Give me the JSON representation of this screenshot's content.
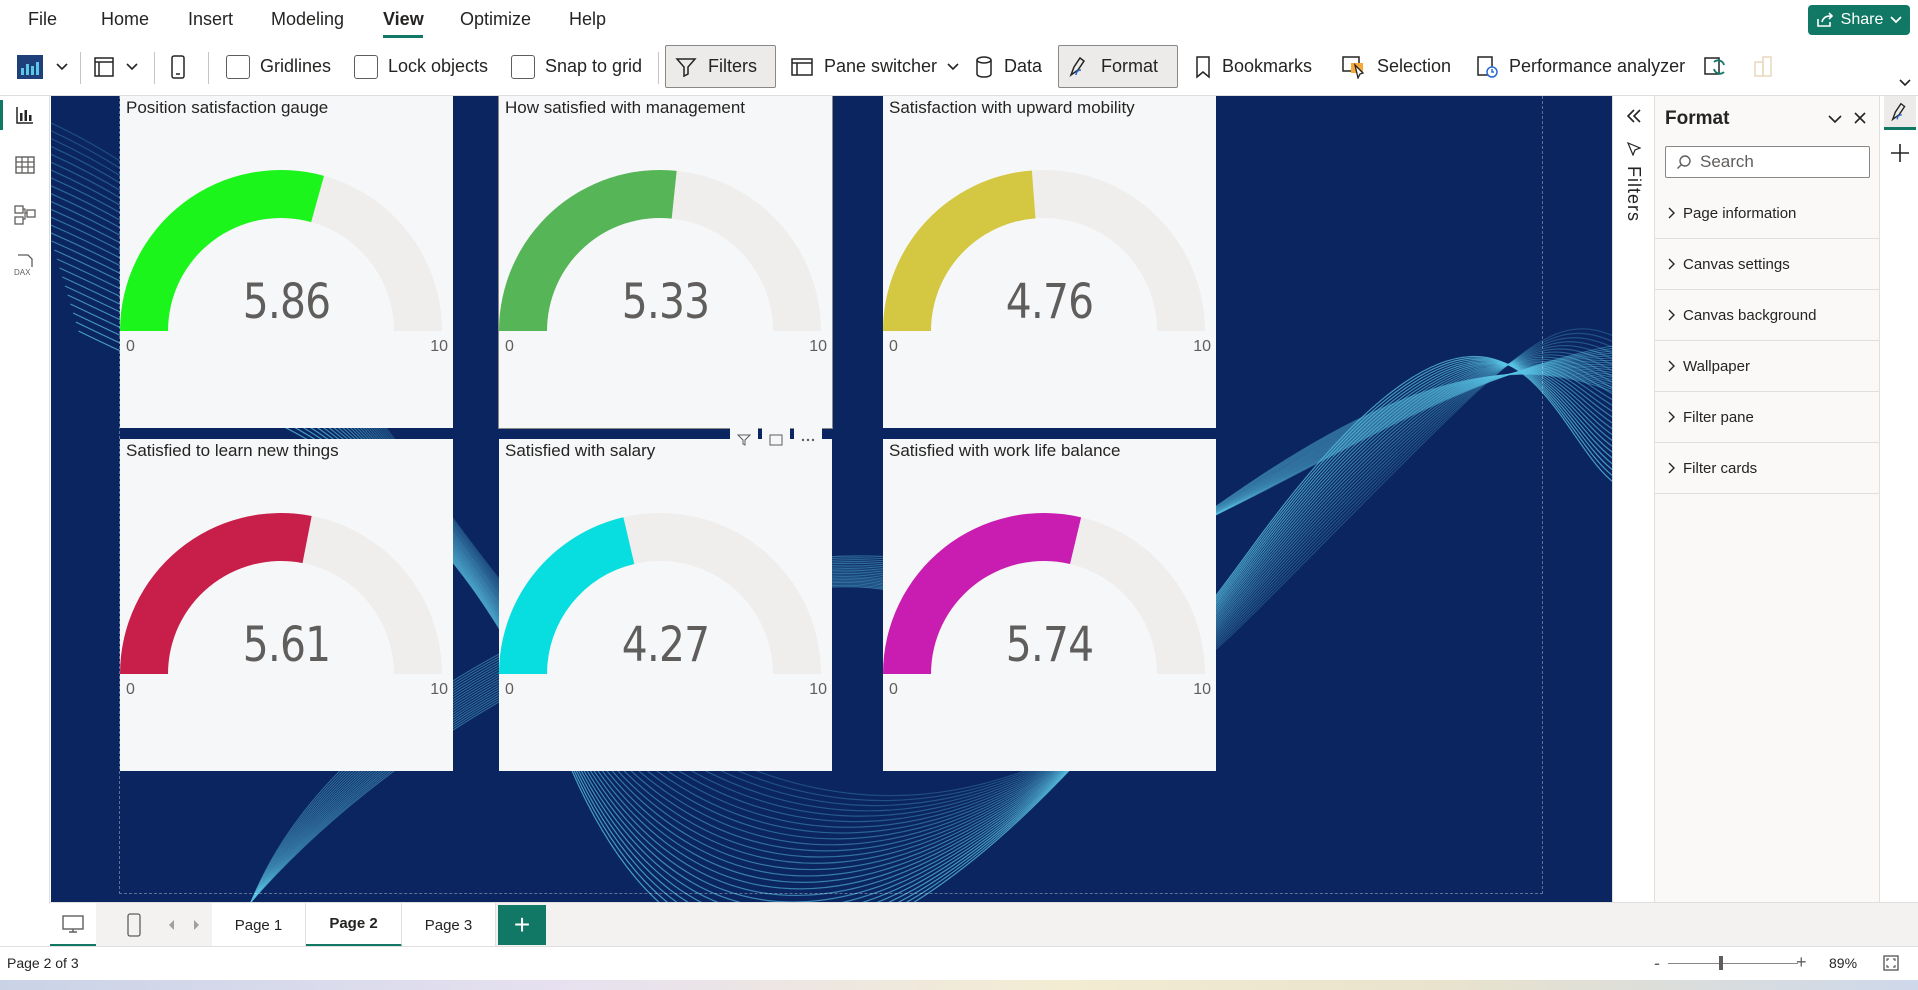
{
  "menu": {
    "items": [
      "File",
      "Home",
      "Insert",
      "Modeling",
      "View",
      "Optimize",
      "Help"
    ],
    "active": "View",
    "share_label": "Share"
  },
  "ribbon": {
    "gridlines": "Gridlines",
    "lock_objects": "Lock objects",
    "snap_to_grid": "Snap to grid",
    "filters": "Filters",
    "pane_switcher": "Pane switcher",
    "data": "Data",
    "format": "Format",
    "bookmarks": "Bookmarks",
    "selection": "Selection",
    "performance_analyzer": "Performance analyzer"
  },
  "gauges": [
    {
      "title": "Position satisfaction gauge",
      "value": "5.86",
      "fraction": 0.586,
      "color": "#1cf51c",
      "min": "0",
      "max": "10"
    },
    {
      "title": "How satisfied with management",
      "value": "5.33",
      "fraction": 0.533,
      "color": "#56b556",
      "min": "0",
      "max": "10"
    },
    {
      "title": "Satisfaction with upward mobility",
      "value": "4.76",
      "fraction": 0.476,
      "color": "#d4c842",
      "min": "0",
      "max": "10"
    },
    {
      "title": "Satisfied to learn new things",
      "value": "5.61",
      "fraction": 0.561,
      "color": "#c81f4a",
      "min": "0",
      "max": "10"
    },
    {
      "title": "Satisfied with salary",
      "value": "4.27",
      "fraction": 0.427,
      "color": "#08dee0",
      "min": "0",
      "max": "10"
    },
    {
      "title": "Satisfied with work life balance",
      "value": "5.74",
      "fraction": 0.574,
      "color": "#c81db0",
      "min": "0",
      "max": "10"
    }
  ],
  "filters_pane": {
    "label": "Filters"
  },
  "format_pane": {
    "title": "Format",
    "search_placeholder": "Search",
    "sections": [
      "Page information",
      "Canvas settings",
      "Canvas background",
      "Wallpaper",
      "Filter pane",
      "Filter cards"
    ]
  },
  "pages": {
    "tabs": [
      "Page 1",
      "Page 2",
      "Page 3"
    ],
    "active": "Page 2",
    "add_label": "+"
  },
  "status": {
    "page_indicator": "Page 2 of 3",
    "zoom": "89%"
  },
  "colors": {
    "accent": "#117865",
    "canvas_bg": "#0b2560",
    "wave": "#5bc6e6"
  }
}
